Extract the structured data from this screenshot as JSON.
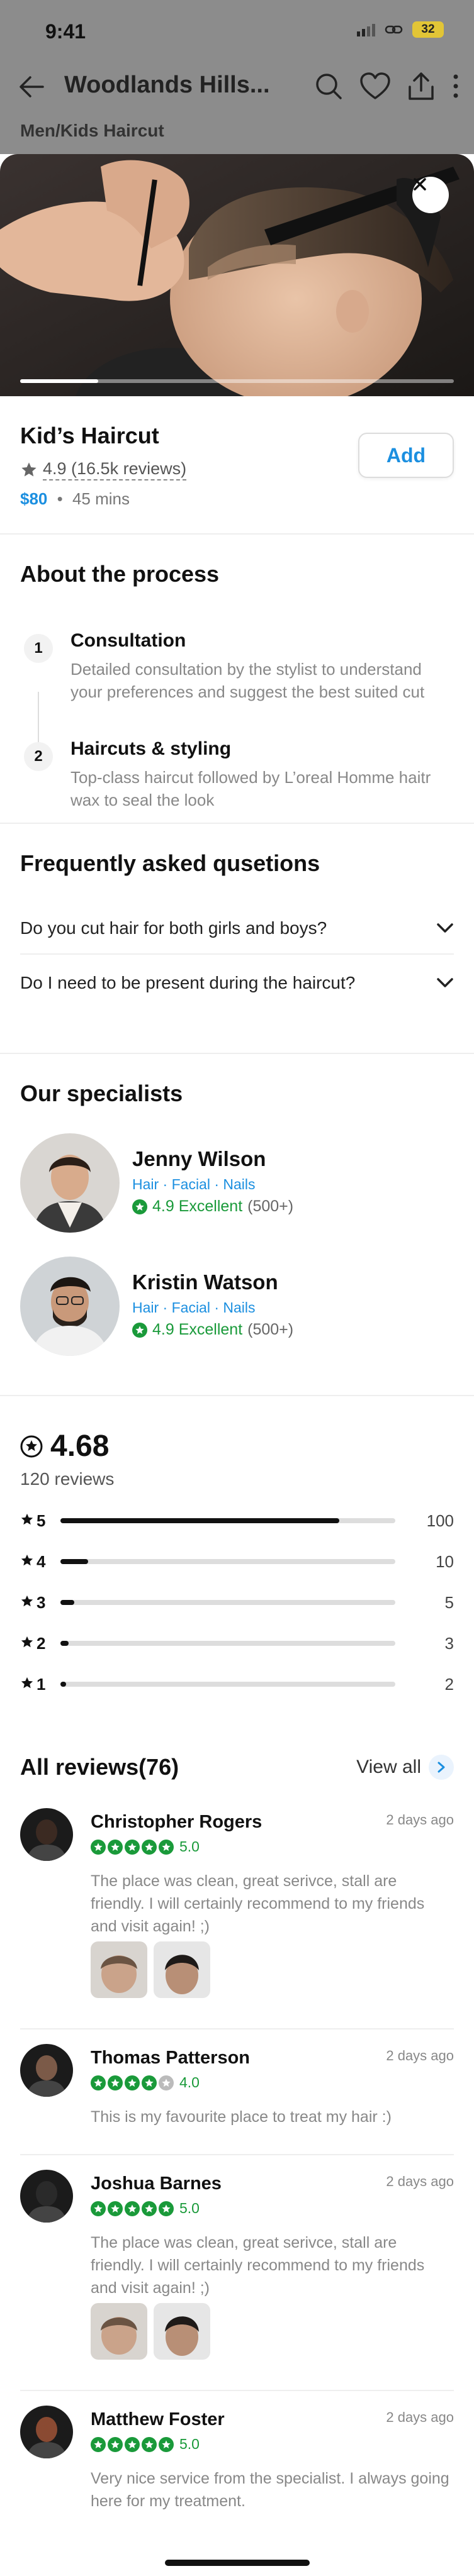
{
  "status": {
    "time": "9:41",
    "battery": "32"
  },
  "nav": {
    "title": "Woodlands Hills..."
  },
  "breadcrumb": "Men/Kids Haircut",
  "hero": {
    "progress": 0.18
  },
  "service": {
    "name": "Kid’s Haircut",
    "rating": "4.9 (16.5k reviews)",
    "price": "$80",
    "separator": "•",
    "duration": "45 mins",
    "add_label": "Add"
  },
  "process": {
    "title": "About the process",
    "steps": [
      {
        "num": "1",
        "title": "Consultation",
        "desc": "Detailed consultation by the stylist to understand your preferences and suggest the best suited cut"
      },
      {
        "num": "2",
        "title": "Haircuts & styling",
        "desc": "Top-class haircut followed by L’oreal Homme haitr wax to seal the look"
      }
    ]
  },
  "faq": {
    "title": "Frequently asked qusetions",
    "items": [
      "Do you cut hair for both girls and boys?",
      "Do I need to be present during the haircut?"
    ]
  },
  "specialists": {
    "title": "Our specialists",
    "items": [
      {
        "name": "Jenny Wilson",
        "tags": "Hair · Facial · Nails",
        "rating": "4.9 Excellent",
        "count": "(500+)"
      },
      {
        "name": "Kristin Watson",
        "tags": "Hair · Facial · Nails",
        "rating": "4.9 Excellent",
        "count": "(500+)"
      }
    ]
  },
  "summary": {
    "average": "4.68",
    "count": "120 reviews",
    "distribution": [
      {
        "star": "5",
        "count": "100",
        "value": 100
      },
      {
        "star": "4",
        "count": "10",
        "value": 10
      },
      {
        "star": "3",
        "count": "5",
        "value": 5
      },
      {
        "star": "2",
        "count": "3",
        "value": 3
      },
      {
        "star": "1",
        "count": "2",
        "value": 2
      }
    ],
    "max": 120
  },
  "reviews": {
    "title": "All reviews(76)",
    "view_all": "View all",
    "items": [
      {
        "name": "Christopher Rogers",
        "date": "2 days ago",
        "score": "5.0",
        "stars": 5,
        "text": "The place was clean, great serivce, stall are friendly. I will certainly recommend to my friends and visit again! ;)"
      },
      {
        "name": "Thomas Patterson",
        "date": "2 days ago",
        "score": "4.0",
        "stars": 4,
        "text": "This is my favourite place to treat my hair :)"
      },
      {
        "name": "Joshua Barnes",
        "date": "2 days ago",
        "score": "5.0",
        "stars": 5,
        "text": "The place was clean, great serivce, stall are friendly. I will certainly recommend to my friends and visit again! ;)"
      },
      {
        "name": "Matthew Foster",
        "date": "2 days ago",
        "score": "5.0",
        "stars": 5,
        "text": "Very nice service from the specialist. I always going here for my treatment."
      }
    ]
  },
  "colors": {
    "accent": "#1b8fe0",
    "success": "#1a9a3a",
    "backdrop": "#8c8c8c"
  }
}
